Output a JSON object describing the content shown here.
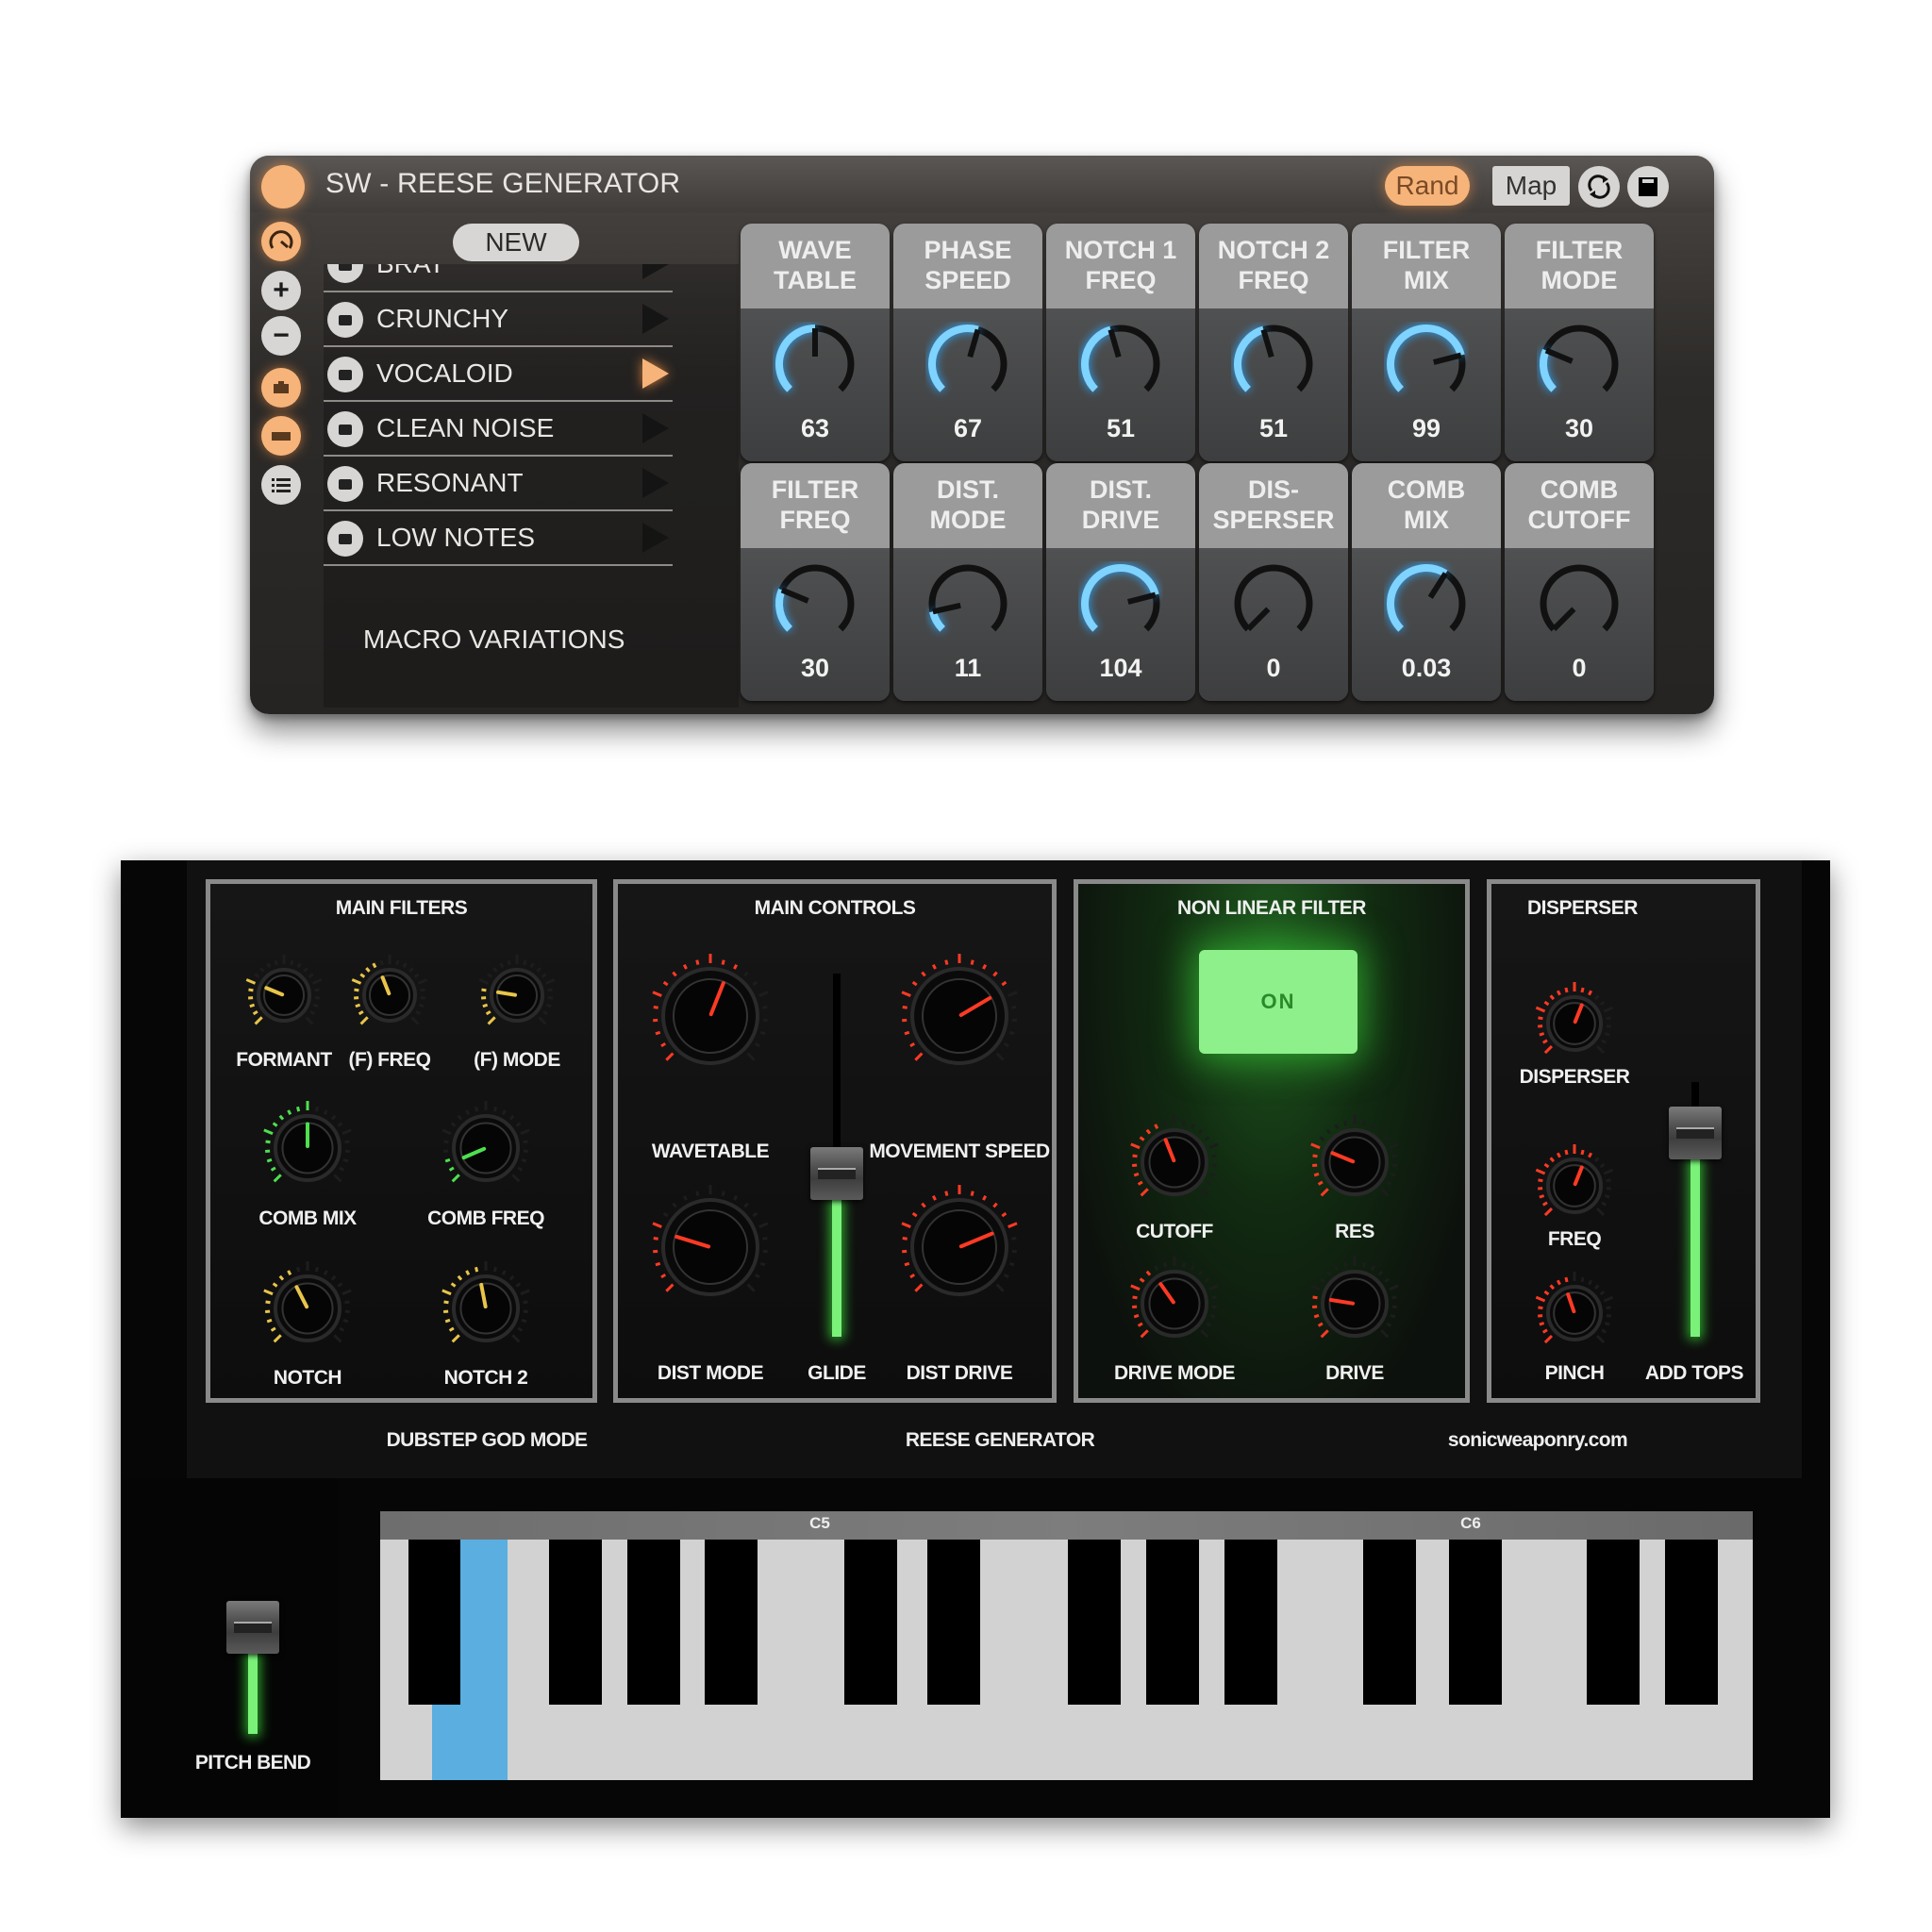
{
  "top": {
    "title": "SW - REESE GENERATOR",
    "rand_label": "Rand",
    "map_label": "Map",
    "new_label": "NEW",
    "macro_label": "MACRO VARIATIONS",
    "side_icons": [
      "knob-icon",
      "plus-icon",
      "minus-icon",
      "camera-icon",
      "minus-bar-icon",
      "list-icon"
    ],
    "presets": [
      {
        "label": "BRAT",
        "active": false
      },
      {
        "label": "CRUNCHY",
        "active": false
      },
      {
        "label": "VOCALOID",
        "active": true
      },
      {
        "label": "CLEAN NOISE",
        "active": false
      },
      {
        "label": "RESONANT",
        "active": false
      },
      {
        "label": "LOW NOTES",
        "active": false
      }
    ],
    "knobs": [
      {
        "label": "WAVE\nTABLE",
        "value": "63",
        "norm": 0.5
      },
      {
        "label": "PHASE\nSPEED",
        "value": "67",
        "norm": 0.56
      },
      {
        "label": "NOTCH 1\nFREQ",
        "value": "51",
        "norm": 0.44
      },
      {
        "label": "NOTCH 2\nFREQ",
        "value": "51",
        "norm": 0.44
      },
      {
        "label": "FILTER\nMIX",
        "value": "99",
        "norm": 0.78
      },
      {
        "label": "FILTER\nMODE",
        "value": "30",
        "norm": 0.25
      },
      {
        "label": "FILTER\nFREQ",
        "value": "30",
        "norm": 0.25
      },
      {
        "label": "DIST.\nMODE",
        "value": "11",
        "norm": 0.12
      },
      {
        "label": "DIST.\nDRIVE",
        "value": "104",
        "norm": 0.78
      },
      {
        "label": "DIS-\nSPERSER",
        "value": "0",
        "norm": 0.0
      },
      {
        "label": "COMB\nMIX",
        "value": "0.03",
        "norm": 0.62
      },
      {
        "label": "COMB\nCUTOFF",
        "value": "0",
        "norm": 0.0
      }
    ],
    "accent": "#f6b47a",
    "knob_color": "#7fd3ff"
  },
  "bottom": {
    "sections": {
      "main_filters": {
        "title": "MAIN FILTERS",
        "knobs": [
          {
            "label": "FORMANT",
            "norm": 0.25,
            "color": "#e8c54a"
          },
          {
            "label": "(F) FREQ",
            "norm": 0.42,
            "color": "#e8c54a"
          },
          {
            "label": "(F) MODE",
            "norm": 0.2,
            "color": "#e8c54a"
          },
          {
            "label": "COMB MIX",
            "norm": 0.5,
            "color": "#4ee04e"
          },
          {
            "label": "COMB FREQ",
            "norm": 0.08,
            "color": "#4ee04e"
          },
          {
            "label": "NOTCH",
            "norm": 0.4,
            "color": "#e8c54a"
          },
          {
            "label": "NOTCH 2",
            "norm": 0.46,
            "color": "#e8c54a"
          }
        ]
      },
      "main_controls": {
        "title": "MAIN CONTROLS",
        "knobs": [
          {
            "label": "WAVETABLE",
            "norm": 0.58,
            "color": "#ff3a24"
          },
          {
            "label": "MOVEMENT SPEED",
            "norm": 0.72,
            "color": "#ff3a24"
          },
          {
            "label": "DIST MODE",
            "norm": 0.23,
            "color": "#ff3a24"
          },
          {
            "label": "DIST DRIVE",
            "norm": 0.75,
            "color": "#ff3a24"
          }
        ],
        "glide": {
          "label": "GLIDE",
          "level": 0.45
        }
      },
      "non_linear_filter": {
        "title": "NON LINEAR FILTER",
        "on_label": "ON",
        "knobs": [
          {
            "label": "CUTOFF",
            "norm": 0.42,
            "color": "#ff3a24"
          },
          {
            "label": "RES",
            "norm": 0.25,
            "color": "#ff3a24"
          },
          {
            "label": "DRIVE MODE",
            "norm": 0.37,
            "color": "#ff3a24"
          },
          {
            "label": "DRIVE",
            "norm": 0.2,
            "color": "#ff3a24"
          }
        ]
      },
      "disperser": {
        "title": "DISPERSER",
        "knobs": [
          {
            "label": "DISPERSER",
            "norm": 0.58,
            "color": "#ff3a24"
          },
          {
            "label": "FREQ",
            "norm": 0.58,
            "color": "#ff3a24"
          },
          {
            "label": "PINCH",
            "norm": 0.43,
            "color": "#ff3a24"
          }
        ],
        "add_tops": {
          "label": "ADD TOPS",
          "level": 0.8
        }
      }
    },
    "footer": {
      "left": "DUBSTEP GOD MODE",
      "center": "REESE GENERATOR",
      "right": "sonicweaponry.com"
    },
    "keyboard": {
      "octave_labels": [
        "C5",
        "C6"
      ],
      "pressed_key": "A4"
    },
    "pitch_bend": {
      "label": "PITCH BEND",
      "level": 0.5
    }
  }
}
